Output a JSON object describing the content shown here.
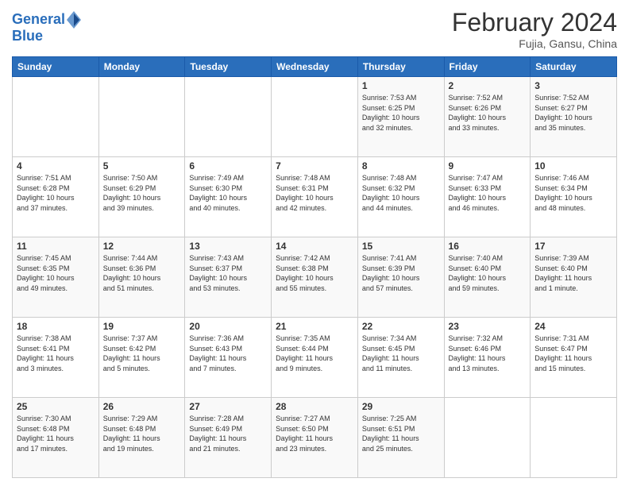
{
  "header": {
    "logo_line1": "General",
    "logo_line2": "Blue",
    "month_title": "February 2024",
    "location": "Fujia, Gansu, China"
  },
  "days_of_week": [
    "Sunday",
    "Monday",
    "Tuesday",
    "Wednesday",
    "Thursday",
    "Friday",
    "Saturday"
  ],
  "weeks": [
    [
      {
        "day": "",
        "info": ""
      },
      {
        "day": "",
        "info": ""
      },
      {
        "day": "",
        "info": ""
      },
      {
        "day": "",
        "info": ""
      },
      {
        "day": "1",
        "info": "Sunrise: 7:53 AM\nSunset: 6:25 PM\nDaylight: 10 hours\nand 32 minutes."
      },
      {
        "day": "2",
        "info": "Sunrise: 7:52 AM\nSunset: 6:26 PM\nDaylight: 10 hours\nand 33 minutes."
      },
      {
        "day": "3",
        "info": "Sunrise: 7:52 AM\nSunset: 6:27 PM\nDaylight: 10 hours\nand 35 minutes."
      }
    ],
    [
      {
        "day": "4",
        "info": "Sunrise: 7:51 AM\nSunset: 6:28 PM\nDaylight: 10 hours\nand 37 minutes."
      },
      {
        "day": "5",
        "info": "Sunrise: 7:50 AM\nSunset: 6:29 PM\nDaylight: 10 hours\nand 39 minutes."
      },
      {
        "day": "6",
        "info": "Sunrise: 7:49 AM\nSunset: 6:30 PM\nDaylight: 10 hours\nand 40 minutes."
      },
      {
        "day": "7",
        "info": "Sunrise: 7:48 AM\nSunset: 6:31 PM\nDaylight: 10 hours\nand 42 minutes."
      },
      {
        "day": "8",
        "info": "Sunrise: 7:48 AM\nSunset: 6:32 PM\nDaylight: 10 hours\nand 44 minutes."
      },
      {
        "day": "9",
        "info": "Sunrise: 7:47 AM\nSunset: 6:33 PM\nDaylight: 10 hours\nand 46 minutes."
      },
      {
        "day": "10",
        "info": "Sunrise: 7:46 AM\nSunset: 6:34 PM\nDaylight: 10 hours\nand 48 minutes."
      }
    ],
    [
      {
        "day": "11",
        "info": "Sunrise: 7:45 AM\nSunset: 6:35 PM\nDaylight: 10 hours\nand 49 minutes."
      },
      {
        "day": "12",
        "info": "Sunrise: 7:44 AM\nSunset: 6:36 PM\nDaylight: 10 hours\nand 51 minutes."
      },
      {
        "day": "13",
        "info": "Sunrise: 7:43 AM\nSunset: 6:37 PM\nDaylight: 10 hours\nand 53 minutes."
      },
      {
        "day": "14",
        "info": "Sunrise: 7:42 AM\nSunset: 6:38 PM\nDaylight: 10 hours\nand 55 minutes."
      },
      {
        "day": "15",
        "info": "Sunrise: 7:41 AM\nSunset: 6:39 PM\nDaylight: 10 hours\nand 57 minutes."
      },
      {
        "day": "16",
        "info": "Sunrise: 7:40 AM\nSunset: 6:40 PM\nDaylight: 10 hours\nand 59 minutes."
      },
      {
        "day": "17",
        "info": "Sunrise: 7:39 AM\nSunset: 6:40 PM\nDaylight: 11 hours\nand 1 minute."
      }
    ],
    [
      {
        "day": "18",
        "info": "Sunrise: 7:38 AM\nSunset: 6:41 PM\nDaylight: 11 hours\nand 3 minutes."
      },
      {
        "day": "19",
        "info": "Sunrise: 7:37 AM\nSunset: 6:42 PM\nDaylight: 11 hours\nand 5 minutes."
      },
      {
        "day": "20",
        "info": "Sunrise: 7:36 AM\nSunset: 6:43 PM\nDaylight: 11 hours\nand 7 minutes."
      },
      {
        "day": "21",
        "info": "Sunrise: 7:35 AM\nSunset: 6:44 PM\nDaylight: 11 hours\nand 9 minutes."
      },
      {
        "day": "22",
        "info": "Sunrise: 7:34 AM\nSunset: 6:45 PM\nDaylight: 11 hours\nand 11 minutes."
      },
      {
        "day": "23",
        "info": "Sunrise: 7:32 AM\nSunset: 6:46 PM\nDaylight: 11 hours\nand 13 minutes."
      },
      {
        "day": "24",
        "info": "Sunrise: 7:31 AM\nSunset: 6:47 PM\nDaylight: 11 hours\nand 15 minutes."
      }
    ],
    [
      {
        "day": "25",
        "info": "Sunrise: 7:30 AM\nSunset: 6:48 PM\nDaylight: 11 hours\nand 17 minutes."
      },
      {
        "day": "26",
        "info": "Sunrise: 7:29 AM\nSunset: 6:48 PM\nDaylight: 11 hours\nand 19 minutes."
      },
      {
        "day": "27",
        "info": "Sunrise: 7:28 AM\nSunset: 6:49 PM\nDaylight: 11 hours\nand 21 minutes."
      },
      {
        "day": "28",
        "info": "Sunrise: 7:27 AM\nSunset: 6:50 PM\nDaylight: 11 hours\nand 23 minutes."
      },
      {
        "day": "29",
        "info": "Sunrise: 7:25 AM\nSunset: 6:51 PM\nDaylight: 11 hours\nand 25 minutes."
      },
      {
        "day": "",
        "info": ""
      },
      {
        "day": "",
        "info": ""
      }
    ]
  ]
}
